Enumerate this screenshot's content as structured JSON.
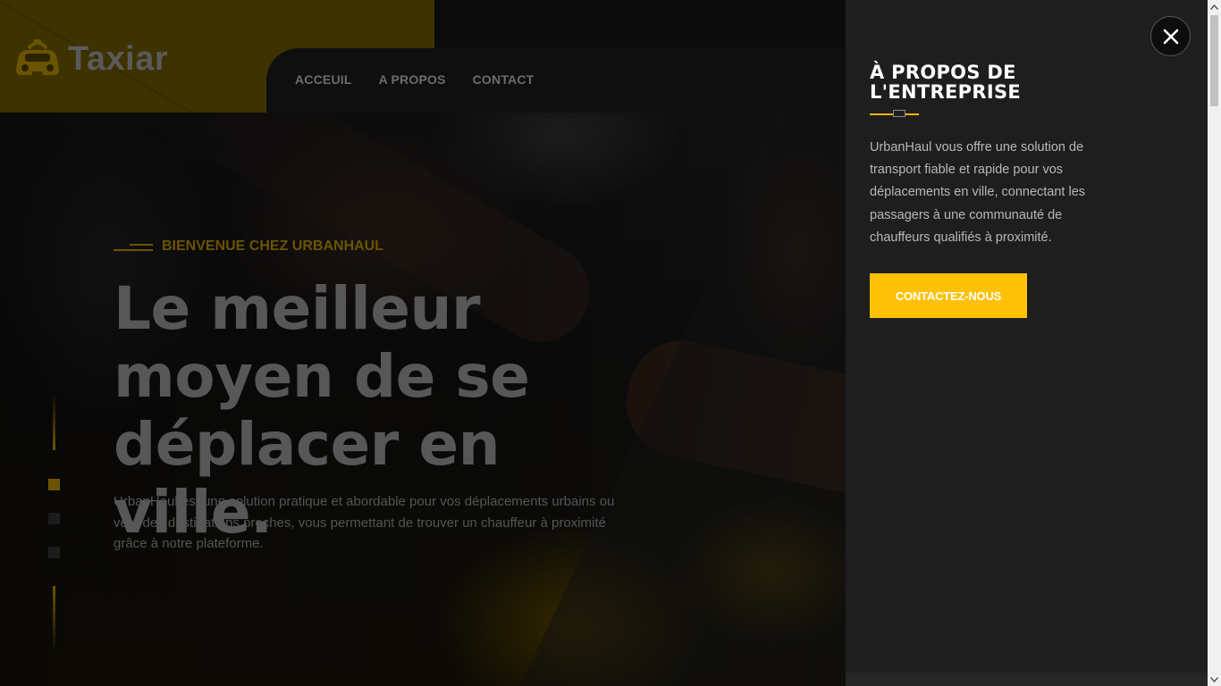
{
  "brand": {
    "name": "Taxiar",
    "accent_color": "#ffc107"
  },
  "nav": {
    "items": [
      {
        "label": "ACCEUIL"
      },
      {
        "label": "A PROPOS"
      },
      {
        "label": "CONTACT"
      }
    ]
  },
  "hero": {
    "eyebrow": "BIENVENUE CHEZ URBANHAUL",
    "headline_line1": "Le meilleur",
    "headline_line2": "moyen de se",
    "headline_line3": "déplacer en ville.",
    "lead_line1": "UrbanHaul est une solution pratique et abordable pour vos déplacements urbains ou",
    "lead_line2": "vers des destinations proches, vous permettant de trouver un chauffeur à proximité",
    "lead_line3": "grâce à notre plateforme.",
    "slider": {
      "slides": 3,
      "active_index": 0
    }
  },
  "panel": {
    "title_line1": "À PROPOS DE",
    "title_line2": "L'ENTREPRISE",
    "text_line1": "UrbanHaul vous offre une solution de",
    "text_line2": "transport fiable et rapide pour vos",
    "text_line3": "déplacements en ville, connectant les",
    "text_line4": "passagers à une communauté de",
    "text_line5": "chauffeurs qualifiés à proximité.",
    "cta_label": "CONTACTEZ-NOUS",
    "close_icon": "close-icon"
  }
}
